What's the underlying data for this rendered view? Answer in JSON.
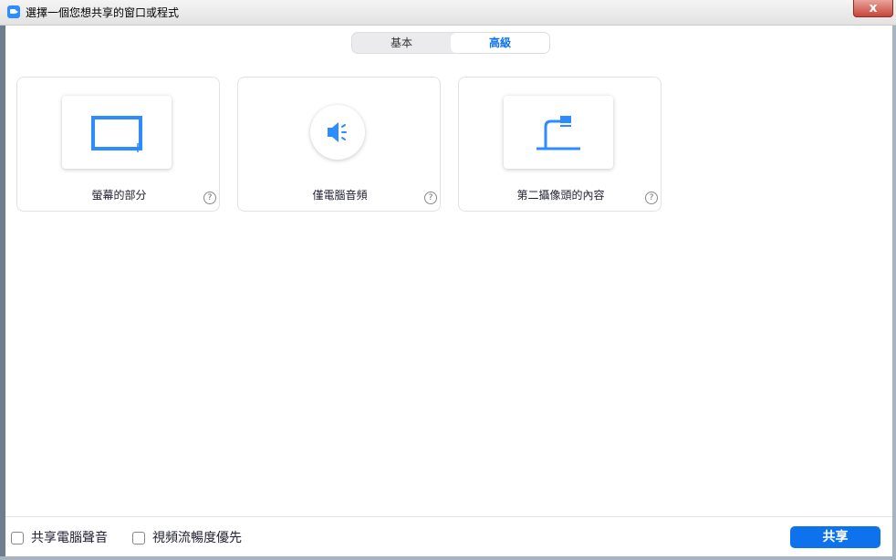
{
  "window": {
    "title": "選擇一個您想共享的窗口或程式",
    "close_label": "x"
  },
  "tabs": [
    {
      "label": "基本",
      "selected": false
    },
    {
      "label": "高級",
      "selected": true
    }
  ],
  "options": [
    {
      "label": "螢幕的部分",
      "icon": "screen-portion-icon",
      "help": "?"
    },
    {
      "label": "僅電腦音頻",
      "icon": "speaker-icon",
      "help": "?"
    },
    {
      "label": "第二攝像頭的內容",
      "icon": "document-camera-icon",
      "help": "?"
    }
  ],
  "footer": {
    "share_audio_label": "共享電腦聲音",
    "share_audio_checked": false,
    "optimize_video_label": "視頻流暢度優先",
    "optimize_video_checked": false,
    "share_button_label": "共享"
  },
  "colors": {
    "accent": "#0e72ed",
    "icon_blue": "#2d8cff"
  }
}
